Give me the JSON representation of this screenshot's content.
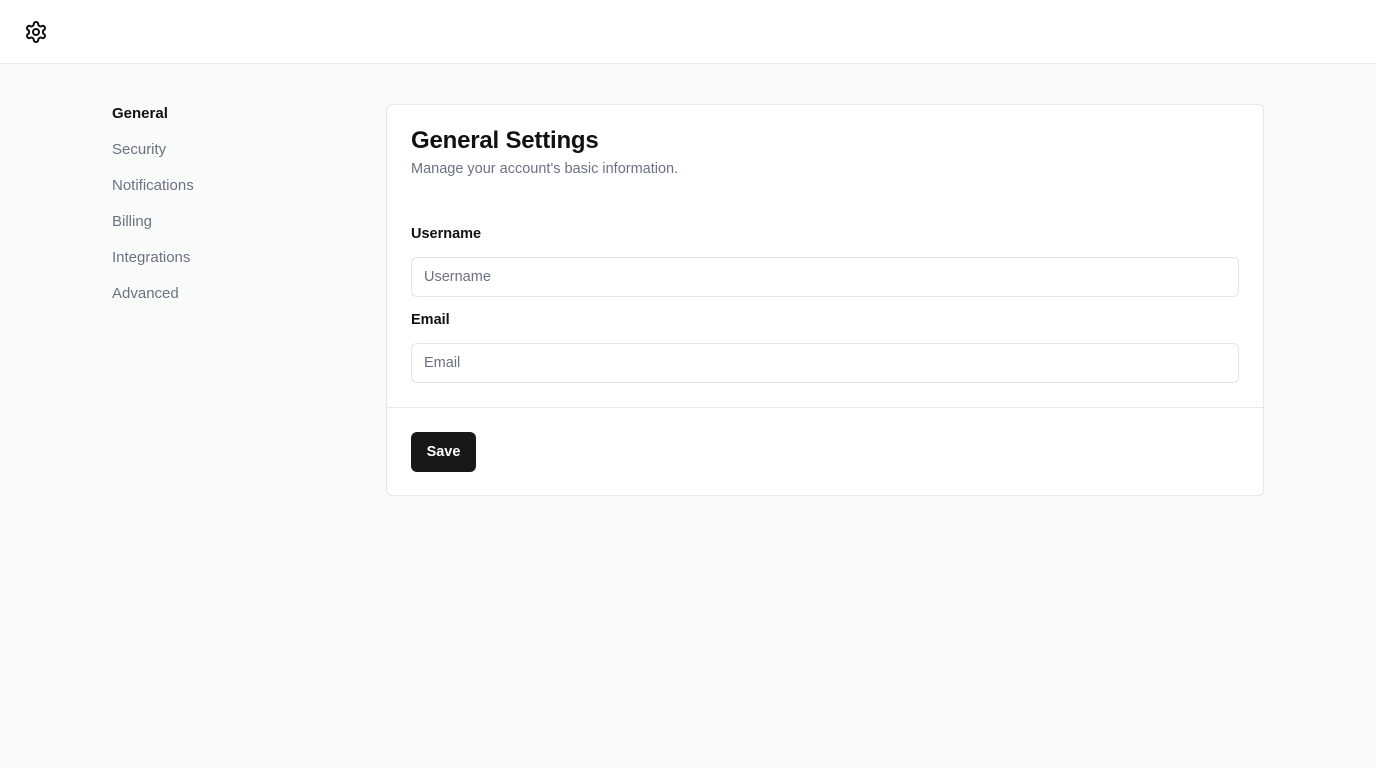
{
  "header": {
    "logo_icon": "gear-icon"
  },
  "sidebar": {
    "items": [
      {
        "label": "General",
        "active": true
      },
      {
        "label": "Security",
        "active": false
      },
      {
        "label": "Notifications",
        "active": false
      },
      {
        "label": "Billing",
        "active": false
      },
      {
        "label": "Integrations",
        "active": false
      },
      {
        "label": "Advanced",
        "active": false
      }
    ]
  },
  "main": {
    "title": "General Settings",
    "subtitle": "Manage your account's basic information.",
    "fields": {
      "username": {
        "label": "Username",
        "placeholder": "Username",
        "value": ""
      },
      "email": {
        "label": "Email",
        "placeholder": "Email",
        "value": ""
      }
    },
    "save_label": "Save"
  },
  "colors": {
    "page_background": "#f9fafa",
    "primary_button": "#18181b",
    "muted_text": "#6b7280",
    "border": "#e5e7eb"
  }
}
